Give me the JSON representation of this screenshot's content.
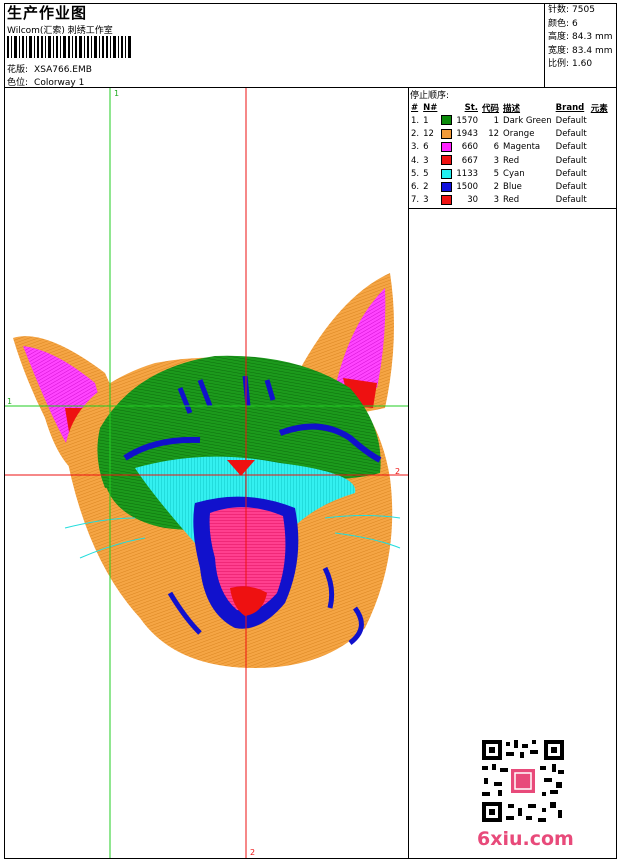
{
  "header": {
    "title": "生产作业图",
    "subtitle": "Wilcom(汇索) 刺绣工作室",
    "file_label": "花版:",
    "file_name": "XSA766.EMB",
    "colorway_label": "色位:",
    "colorway": "Colorway 1"
  },
  "stats": [
    {
      "label": "针数:",
      "value": "7505"
    },
    {
      "label": "颜色:",
      "value": "6"
    },
    {
      "label": "高度:",
      "value": "84.3 mm"
    },
    {
      "label": "宽度:",
      "value": "83.4 mm"
    },
    {
      "label": "比例:",
      "value": "1.60"
    }
  ],
  "sequence": {
    "title": "停止顺序:",
    "headers": [
      "#",
      "N#",
      "St.",
      "代码",
      "描述",
      "Brand",
      "元素"
    ],
    "rows": [
      {
        "idx": "1.",
        "n": "1",
        "color": "#0a8a0a",
        "st": "1570",
        "code": "1",
        "desc": "Dark Green",
        "brand": "Default"
      },
      {
        "idx": "2.",
        "n": "12",
        "color": "#f29a38",
        "st": "1943",
        "code": "12",
        "desc": "Orange",
        "brand": "Default"
      },
      {
        "idx": "3.",
        "n": "6",
        "color": "#ff22ff",
        "st": "660",
        "code": "6",
        "desc": "Magenta",
        "brand": "Default"
      },
      {
        "idx": "4.",
        "n": "3",
        "color": "#ee1111",
        "st": "667",
        "code": "3",
        "desc": "Red",
        "brand": "Default"
      },
      {
        "idx": "5.",
        "n": "5",
        "color": "#22eeee",
        "st": "1133",
        "code": "5",
        "desc": "Cyan",
        "brand": "Default"
      },
      {
        "idx": "6.",
        "n": "2",
        "color": "#1111dd",
        "st": "1500",
        "code": "2",
        "desc": "Blue",
        "brand": "Default"
      },
      {
        "idx": "7.",
        "n": "3",
        "color": "#ee1111",
        "st": "30",
        "code": "3",
        "desc": "Red",
        "brand": "Default"
      }
    ]
  },
  "guides": {
    "v1": "1",
    "h1": "1",
    "h2": "2",
    "v2": "2"
  },
  "watermark": "6xiu.com"
}
